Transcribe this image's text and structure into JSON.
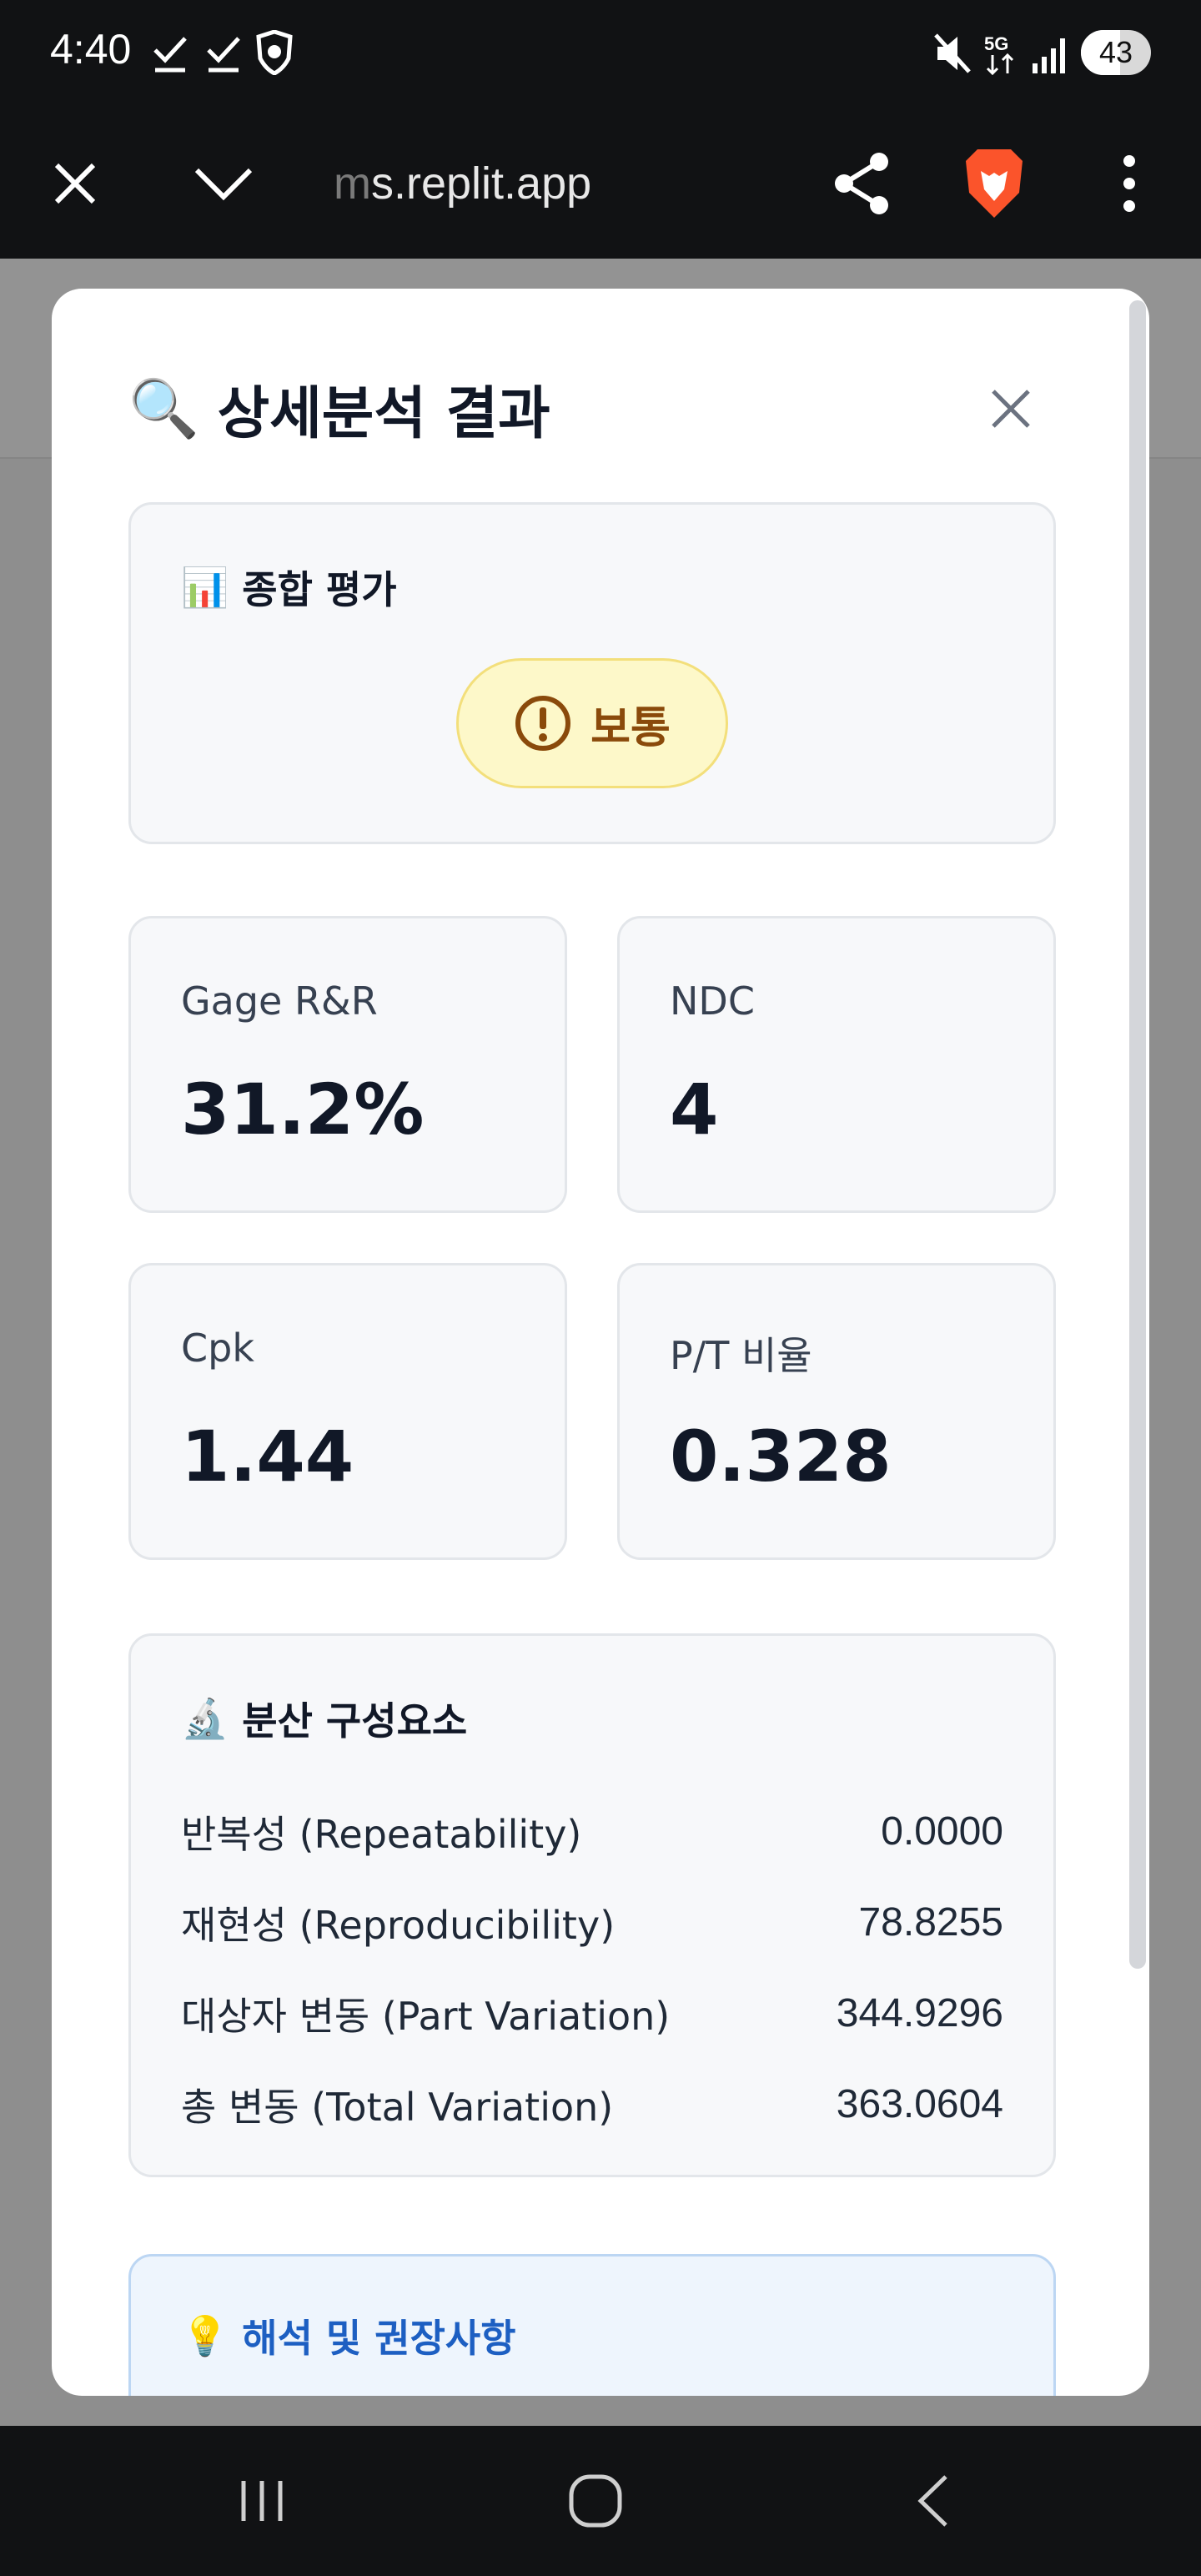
{
  "status_bar": {
    "time": "4:40",
    "network": "5G",
    "battery": "43",
    "icons": [
      "check-icon",
      "check-icon",
      "brave-shield-icon",
      "mute-icon",
      "5g-icon",
      "signal-icon",
      "battery-icon"
    ]
  },
  "browser": {
    "url_prefix": "m",
    "url": "s.replit.app",
    "icons": [
      "close-icon",
      "chevron-down-icon",
      "share-icon",
      "brave-lion-icon",
      "more-vert-icon"
    ]
  },
  "modal": {
    "title_icon": "🔍",
    "title": "상세분석 결과",
    "overall": {
      "icon": "📊",
      "heading": "종합 평가",
      "status_label": "보통",
      "status_color": "#8a4a0b"
    },
    "metrics": [
      {
        "label": "Gage R&R",
        "value": "31.2%"
      },
      {
        "label": "NDC",
        "value": "4"
      },
      {
        "label": "Cpk",
        "value": "1.44"
      },
      {
        "label": "P/T 비율",
        "value": "0.328"
      }
    ],
    "variance": {
      "icon": "🔬",
      "heading": "분산 구성요소",
      "rows": [
        {
          "label": "반복성 (Repeatability)",
          "value": "0.0000"
        },
        {
          "label": "재현성 (Reproducibility)",
          "value": "78.8255"
        },
        {
          "label": "대상자 변동 (Part Variation)",
          "value": "344.9296"
        },
        {
          "label": "총 변동 (Total Variation)",
          "value": "363.0604"
        }
      ]
    },
    "interpretation": {
      "icon": "💡",
      "heading": "해석 및 권장사항"
    }
  },
  "colors": {
    "accent_blue": "#1d5fc2",
    "warning_bg": "#fdf8c9",
    "warning_border": "#f3df7b"
  }
}
